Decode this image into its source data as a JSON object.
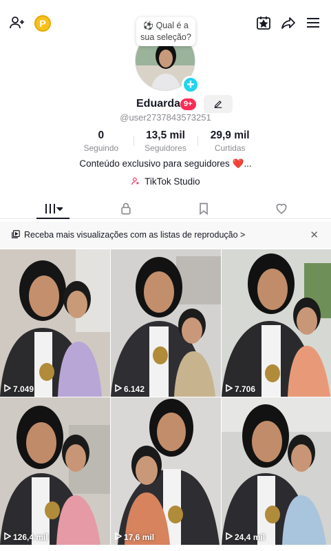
{
  "header": {
    "icons": [
      "add-friend-icon",
      "coin-icon",
      "calendar-star-icon",
      "share-icon",
      "menu-icon"
    ],
    "coin_letter": "P"
  },
  "bubble": {
    "text": "Qual é a sua seleção?",
    "emoji": "⚽"
  },
  "profile": {
    "name": "Eduarda",
    "badge": "9+",
    "handle": "@user2737843573251"
  },
  "stats": [
    {
      "value": "0",
      "label": "Seguindo"
    },
    {
      "value": "13,5 mil",
      "label": "Seguidores"
    },
    {
      "value": "29,9 mil",
      "label": "Curtidas"
    }
  ],
  "bio": {
    "text": "Conteúdo exclusivo para seguidores",
    "suffix": "...",
    "heart": "❤️"
  },
  "studio": {
    "label": "TikTok Studio"
  },
  "tabs": [
    "videos-tab",
    "private-tab",
    "saved-tab",
    "liked-tab"
  ],
  "banner": {
    "text": "Receba mais visualizações com as listas de reprodução >"
  },
  "videos": [
    {
      "views": "7.049"
    },
    {
      "views": "6.142"
    },
    {
      "views": "7.706"
    },
    {
      "views": "126,4 mil"
    },
    {
      "views": "17,6 mil"
    },
    {
      "views": "24,4 mil"
    }
  ],
  "colors": {
    "accent": "#fe2c55",
    "plus": "#20d5ec",
    "coin": "#f6c21c"
  }
}
